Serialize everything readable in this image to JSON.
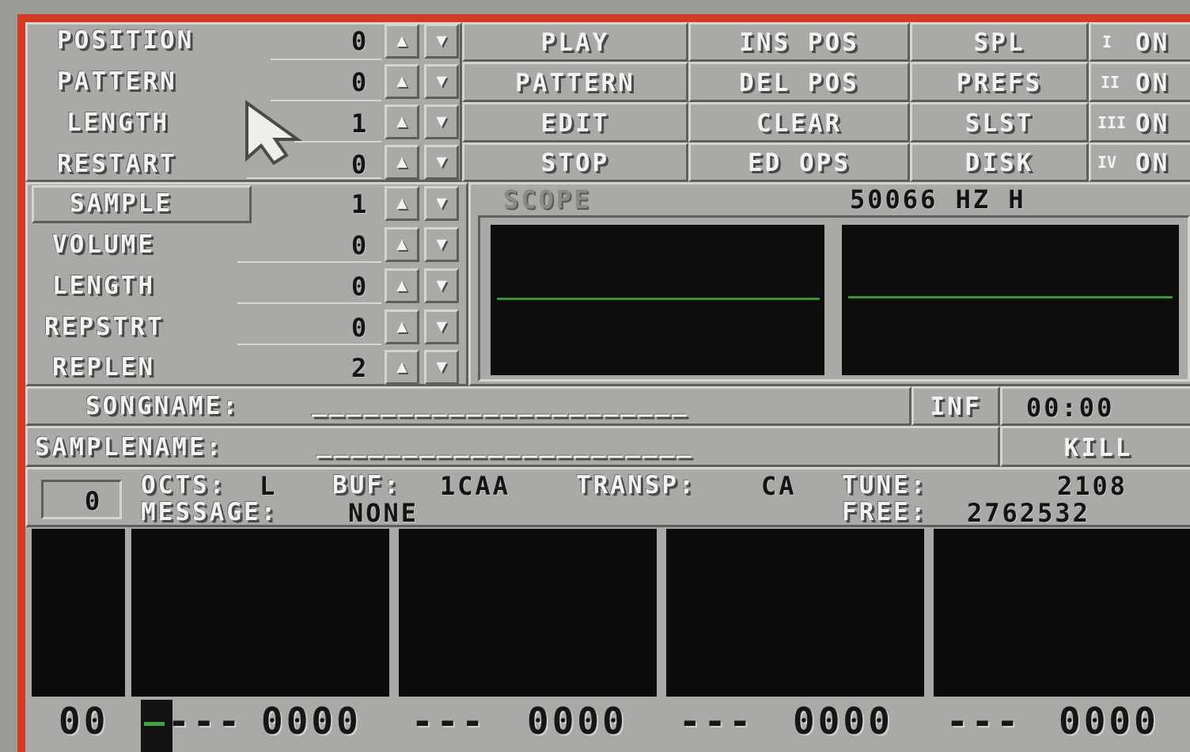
{
  "left_panel": {
    "position": {
      "label": "POSITION",
      "value": "0"
    },
    "pattern": {
      "label": "PATTERN",
      "value": "0"
    },
    "length": {
      "label": "LENGTH",
      "value": "1"
    },
    "restart": {
      "label": "RESTART",
      "value": "0"
    }
  },
  "sample_panel": {
    "sample": {
      "label": "SAMPLE",
      "value": "1"
    },
    "volume": {
      "label": "VOLUME",
      "value": "0"
    },
    "length": {
      "label": "LENGTH",
      "value": "0"
    },
    "repstrt": {
      "label": "REPSTRT",
      "value": "0"
    },
    "replen": {
      "label": "REPLEN",
      "value": "2"
    }
  },
  "menu": {
    "col1": [
      "PLAY",
      "PATTERN",
      "EDIT",
      "STOP"
    ],
    "col2": [
      "INS POS",
      "DEL POS",
      "CLEAR",
      "ED OPS"
    ],
    "col3": [
      "SPL",
      "PREFS",
      "SLST",
      "DISK"
    ],
    "col4": [
      {
        "num": "I",
        "label": "ON"
      },
      {
        "num": "II",
        "label": "ON"
      },
      {
        "num": "III",
        "label": "ON"
      },
      {
        "num": "IV",
        "label": "ON"
      }
    ]
  },
  "scope": {
    "label": "SCOPE",
    "freq": "50066 HZ H"
  },
  "songname": {
    "label": "SONGNAME:",
    "value": "______________________"
  },
  "samplename": {
    "label": "SAMPLENAME:",
    "value": "______________________"
  },
  "inf_button": "INF",
  "timer": "00:00",
  "kill_button": "KILL",
  "status": {
    "octs_label": "OCTS:",
    "octs_value": "L",
    "buf_label": "BUF:",
    "buf_value": "1CAA",
    "transp_label": "TRANSP:",
    "transp_value": "CA",
    "tune_label": "TUNE:",
    "tune_value": "2108",
    "message_label": "MESSAGE:",
    "message_value": "NONE",
    "free_label": "FREE:",
    "free_value": "2762532",
    "indicator": "0"
  },
  "tracker_row": {
    "row": "00",
    "channels": [
      {
        "note": "---",
        "value": "0000"
      },
      {
        "note": "---",
        "value": "0000"
      },
      {
        "note": "---",
        "value": "0000"
      },
      {
        "note": "---",
        "value": "0000"
      }
    ]
  },
  "colors": {
    "accent_red": "#d43a23",
    "scope_green": "#2f9a35",
    "panel_gray": "#a9a9a5"
  }
}
